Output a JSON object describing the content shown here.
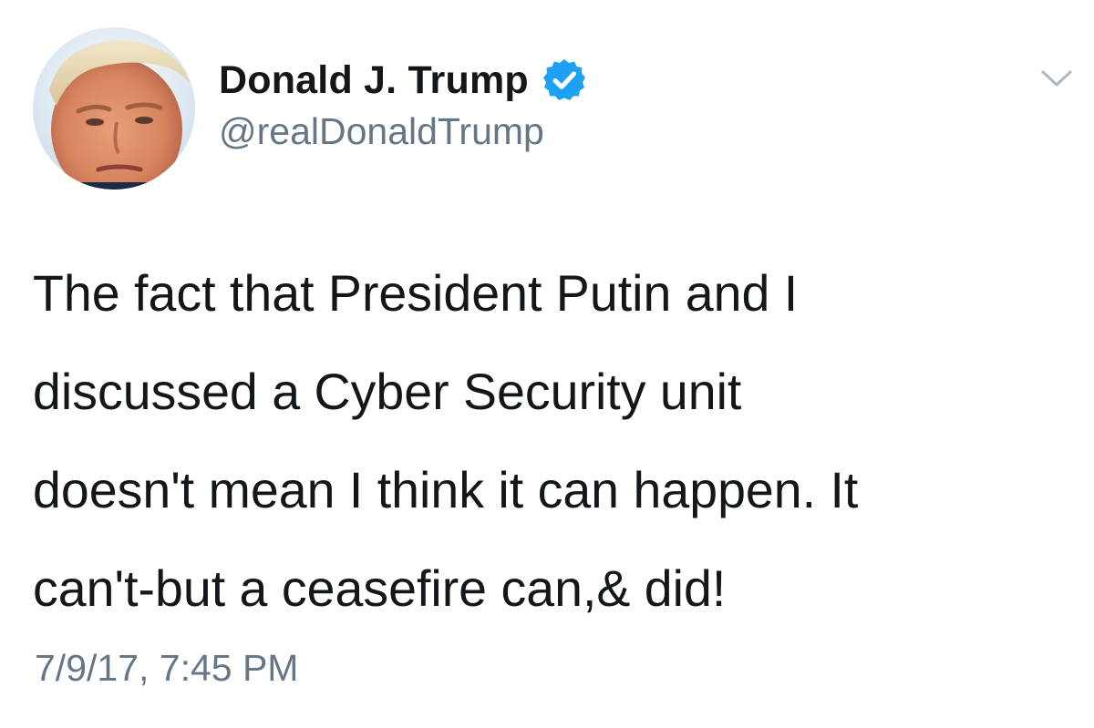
{
  "author": {
    "display_name": "Donald J. Trump",
    "handle": "@realDonaldTrump",
    "verified": true,
    "avatar_icon": "avatar-photo",
    "verified_icon": "verified-badge-icon"
  },
  "menu": {
    "icon": "chevron-down-icon"
  },
  "tweet": {
    "lines": [
      "The fact that President Putin and I",
      "discussed a Cyber Security unit",
      "doesn't mean I think it can happen. It",
      "can't-but a ceasefire can,& did!"
    ],
    "timestamp": "7/9/17, 7:45 PM"
  },
  "colors": {
    "primary_text": "#14171a",
    "secondary_text": "#657786",
    "verified_blue": "#1da1f2",
    "caret": "#aab8c2",
    "background": "#ffffff"
  }
}
